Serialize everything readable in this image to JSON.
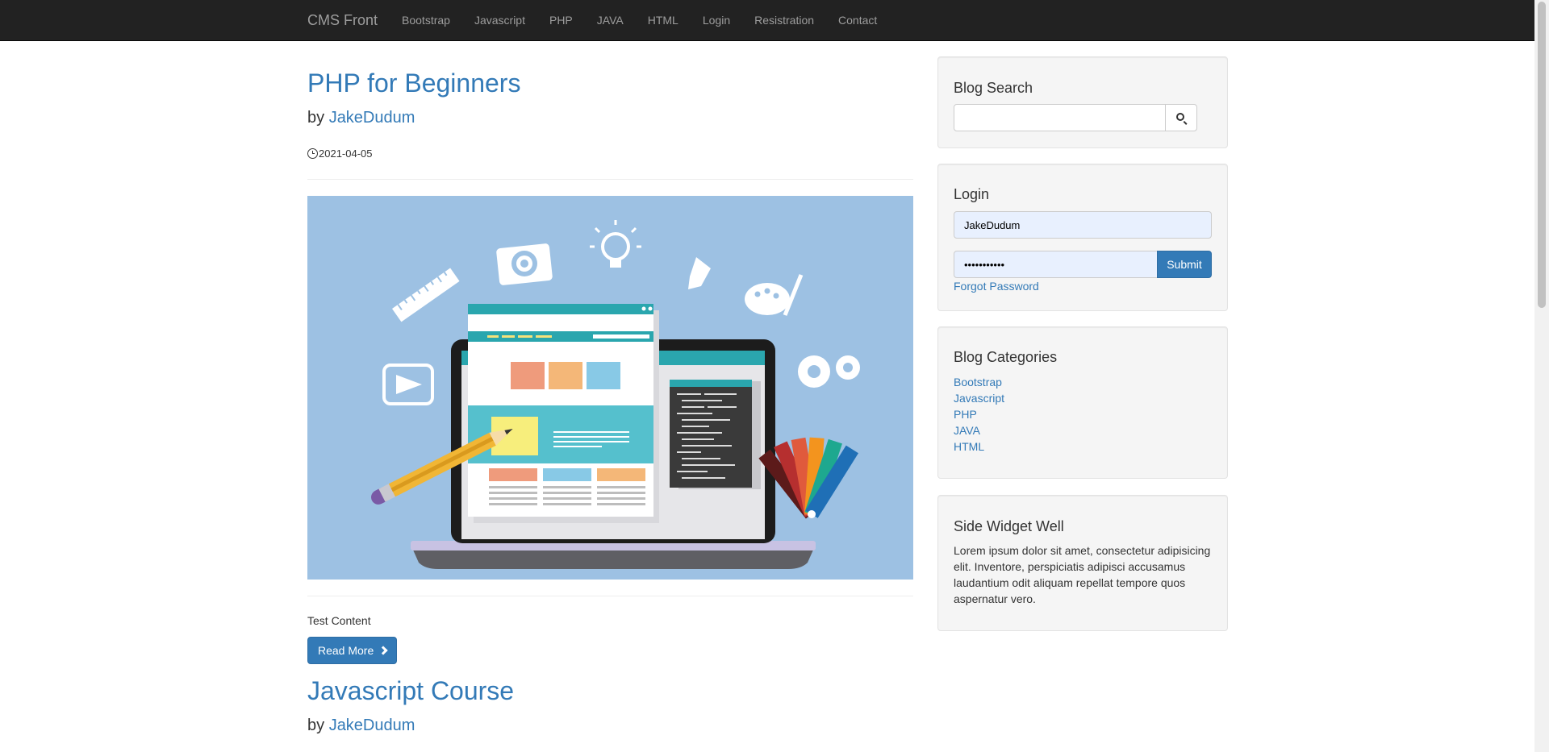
{
  "navbar": {
    "brand": "CMS Front",
    "links": [
      "Bootstrap",
      "Javascript",
      "PHP",
      "JAVA",
      "HTML",
      "Login",
      "Resistration",
      "Contact"
    ]
  },
  "posts": [
    {
      "title": "PHP for Beginners",
      "by_prefix": "by",
      "author": "JakeDudum",
      "date": "2021-04-05",
      "excerpt": "Test Content",
      "read_more": "Read More"
    },
    {
      "title": "Javascript Course",
      "by_prefix": "by",
      "author": "JakeDudum"
    }
  ],
  "sidebar": {
    "search": {
      "title": "Blog Search",
      "value": ""
    },
    "login": {
      "title": "Login",
      "username": "JakeDudum",
      "password": "•••••••••••",
      "submit": "Submit",
      "forgot": "Forgot Password"
    },
    "categories": {
      "title": "Blog Categories",
      "items": [
        "Bootstrap",
        "Javascript",
        "PHP",
        "JAVA",
        "HTML"
      ]
    },
    "widget": {
      "title": "Side Widget Well",
      "text": "Lorem ipsum dolor sit amet, consectetur adipisicing elit. Inventore, perspiciatis adipisci accusamus laudantium odit aliquam repellat tempore quos aspernatur vero."
    }
  },
  "colors": {
    "navbar": "#222222",
    "link": "#337ab7",
    "image_bg": "#9dc1e3"
  }
}
